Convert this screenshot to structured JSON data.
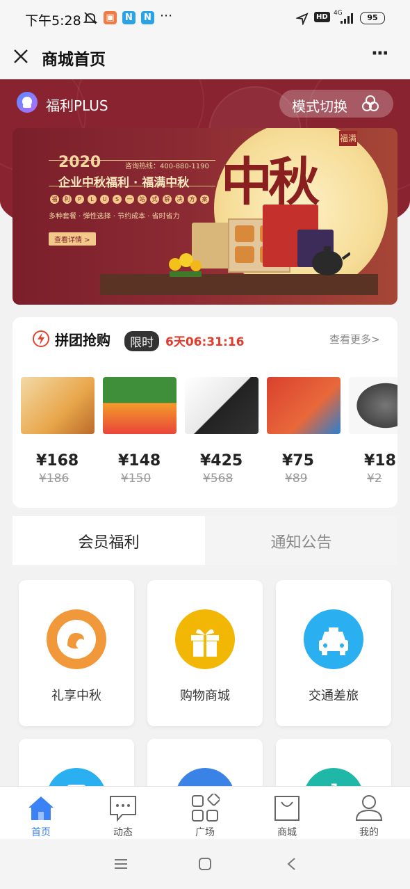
{
  "status_bar": {
    "time": "下午5:28",
    "badge_n": "N",
    "dots": "···",
    "net": "4G",
    "hd": "HD",
    "battery": "95"
  },
  "title_bar": {
    "title": "商城首页",
    "more": "···"
  },
  "banner_header": {
    "brand": "福利PLUS",
    "mode_switch": "模式切换"
  },
  "banner": {
    "year": "2020",
    "hotline": "咨询热线：400-880-1190",
    "headline": "企业中秋福利 · 福满中秋",
    "plus_chars": [
      "福",
      "利",
      "P",
      "L",
      "U",
      "S",
      "一",
      "站",
      "式",
      "解",
      "决",
      "方",
      "案"
    ],
    "tagline": "多种套餐 · 弹性选择 · 节约成本 · 省时省力",
    "cta": "查看详情 >",
    "big_text": "中秋",
    "seal": "福满"
  },
  "group_buy": {
    "title": "拼团抢购",
    "limited": "限时",
    "countdown": "6天06:31:16",
    "more": "查看更多>",
    "products": [
      {
        "price": "¥168",
        "old": "¥186",
        "color": "#e8a64a"
      },
      {
        "price": "¥148",
        "old": "¥150",
        "color": "#3f8f3a"
      },
      {
        "price": "¥425",
        "old": "¥568",
        "color": "#e9e9e9"
      },
      {
        "price": "¥75",
        "old": "¥89",
        "color": "#d9412e"
      },
      {
        "price": "¥18",
        "old": "¥2",
        "color": "#444444"
      }
    ]
  },
  "tabs": {
    "member": "会员福利",
    "notice": "通知公告"
  },
  "services": [
    {
      "label": "礼享中秋",
      "color": "#f0983a"
    },
    {
      "label": "购物商城",
      "color": "#f2b705"
    },
    {
      "label": "交通差旅",
      "color": "#2ab0f0"
    }
  ],
  "services_row2_colors": [
    "#2ab0f0",
    "#3a82e6",
    "#1fb8a8"
  ],
  "bottom_nav": [
    {
      "label": "首页",
      "active": true
    },
    {
      "label": "动态",
      "active": false
    },
    {
      "label": "广场",
      "active": false
    },
    {
      "label": "商城",
      "active": false
    },
    {
      "label": "我的",
      "active": false
    }
  ],
  "colors": {
    "accent": "#3b82f6",
    "countdown": "#e43a2c",
    "banner_bg": "#8a2330"
  }
}
